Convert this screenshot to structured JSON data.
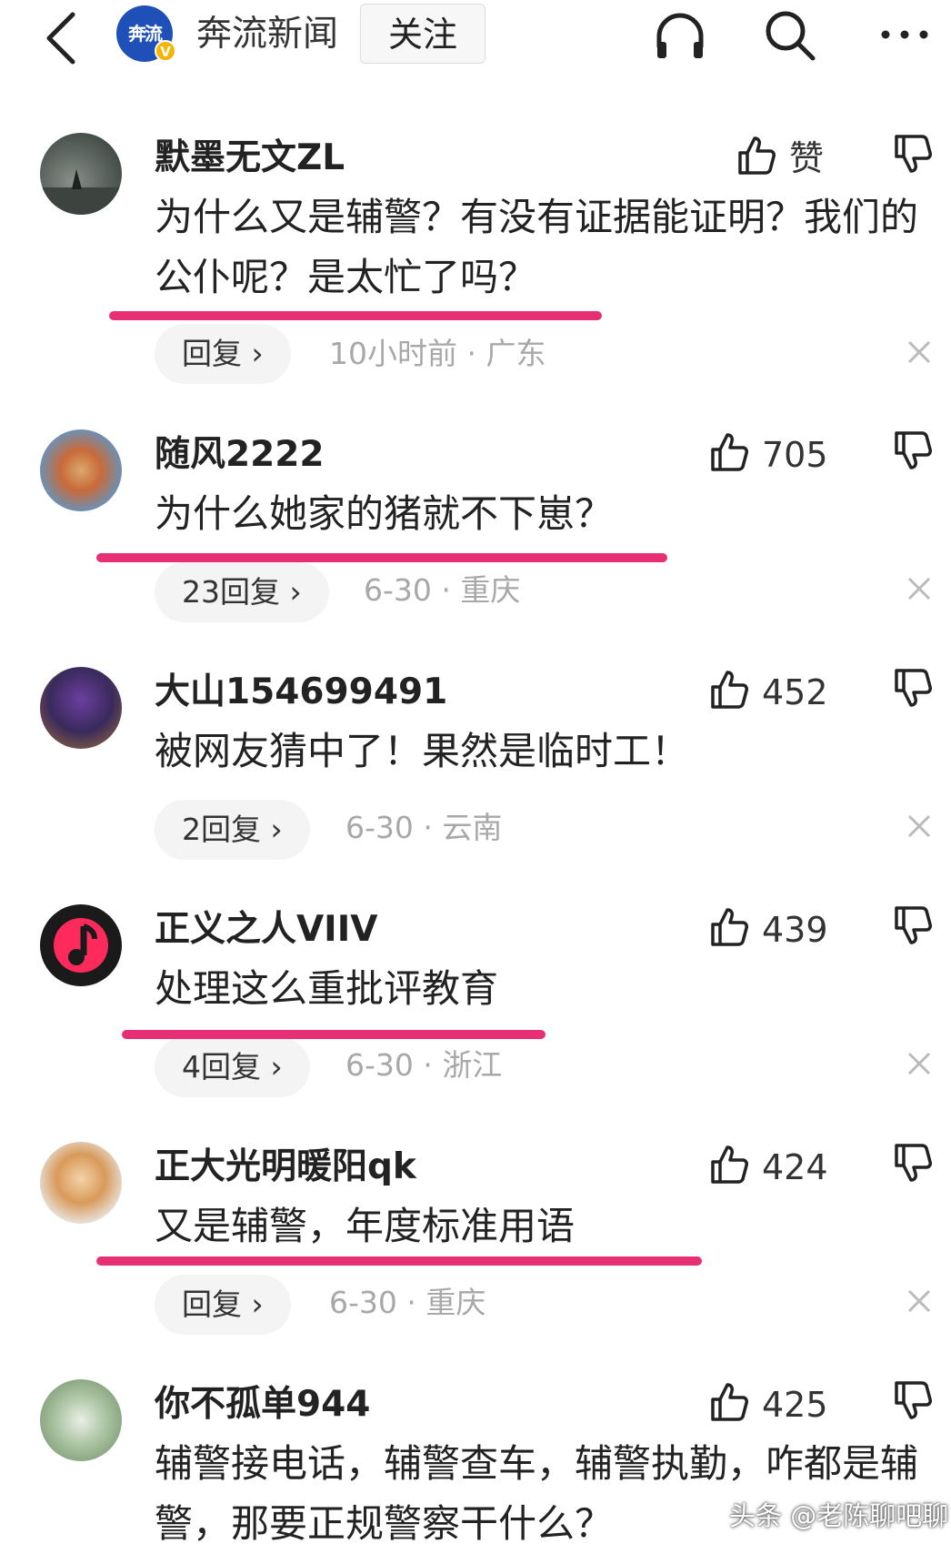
{
  "header": {
    "logo_text": "奔流",
    "verified": "V",
    "source_name": "奔流新闻",
    "follow_label": "关注",
    "icons": [
      "back-icon",
      "headphones-icon",
      "search-icon",
      "more-icon"
    ]
  },
  "comments": [
    {
      "username": "默墨无文ZL",
      "like_label": "赞",
      "text": "为什么又是辅警？有没有证据能证明？我们的公仆呢？是太忙了吗？",
      "reply_label": "回复 ›",
      "time_location": "10小时前 · 广东"
    },
    {
      "username": "随风2222",
      "like_label": "705",
      "text": "为什么她家的猪就不下崽？",
      "reply_label": "23回复 ›",
      "time_location": "6-30 · 重庆"
    },
    {
      "username": "大山154699491",
      "like_label": "452",
      "text": "被网友猜中了！果然是临时工！",
      "reply_label": "2回复 ›",
      "time_location": "6-30 · 云南"
    },
    {
      "username": "正义之人VIIV",
      "like_label": "439",
      "text": "处理这么重批评教育",
      "reply_label": "4回复 ›",
      "time_location": "6-30 · 浙江"
    },
    {
      "username": "正大光明暖阳qk",
      "like_label": "424",
      "text": "又是辅警，年度标准用语",
      "reply_label": "回复 ›",
      "time_location": "6-30 · 重庆"
    },
    {
      "username": "你不孤单944",
      "like_label": "425",
      "text": "辅警接电话，辅警查车，辅警执勤，咋都是辅警，那要正规警察干什么？"
    }
  ],
  "watermark": "头条 @老陈聊吧聊",
  "colors": {
    "highlight": "#e6246e",
    "meta": "#a8a8a8",
    "badge": "#f4b400"
  }
}
